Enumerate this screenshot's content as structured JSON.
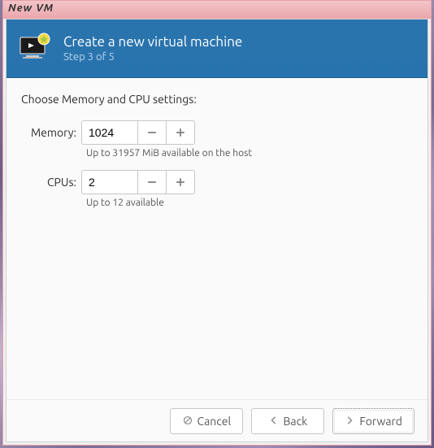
{
  "window": {
    "title": "New  VM"
  },
  "header": {
    "title": "Create a new virtual machine",
    "step": "Step 3 of 5"
  },
  "content": {
    "section_title": "Choose Memory and CPU settings:",
    "memory": {
      "label": "Memory:",
      "value": "1024",
      "hint": "Up to 31957 MiB available on the host"
    },
    "cpus": {
      "label": "CPUs:",
      "value": "2",
      "hint": "Up to 12 available"
    }
  },
  "footer": {
    "cancel": "Cancel",
    "back": "Back",
    "forward": "Forward"
  }
}
